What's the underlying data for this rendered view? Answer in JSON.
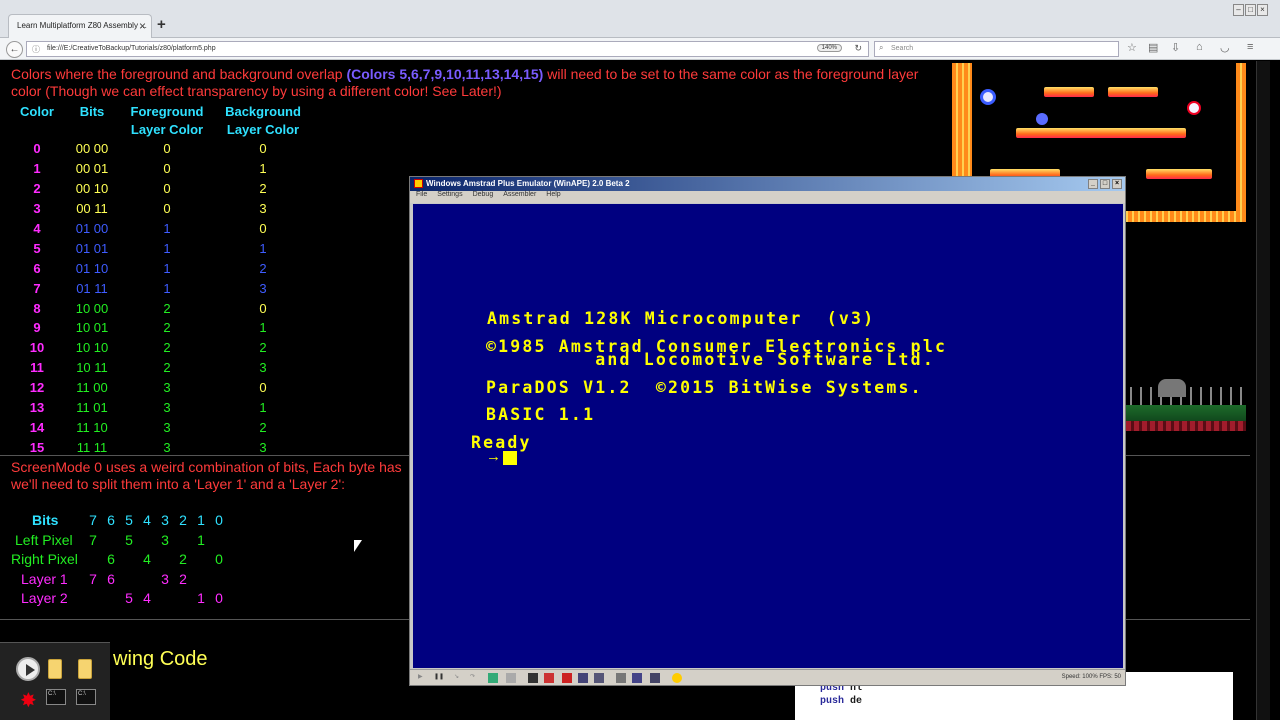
{
  "browser": {
    "tab_title": "Learn Multiplatform Z80 Assembly ...",
    "tab_close": "×",
    "new_tab": "+",
    "url": "file:///E:/CreativeToBackup/Tutorials/z80/platform5.php",
    "zoom": "140%",
    "search_placeholder": "Search"
  },
  "page": {
    "intro_line_plain": "Colors where the foreground and background overlap ",
    "intro_line_highlight": "(Colors 5,6,7,9,10,11,13,14,15)",
    "intro_line_rest": " will need to be set to the same color as the foreground layer color (Though we can effect transparency by using a different color! See Later!)",
    "table": {
      "headers": [
        "Color",
        "Bits",
        "Foreground Layer Color",
        "Background Layer Color"
      ],
      "rows": [
        {
          "color": "0",
          "bits": "00 00",
          "fg": "0",
          "bg": "0"
        },
        {
          "color": "1",
          "bits": "00 01",
          "fg": "0",
          "bg": "1"
        },
        {
          "color": "2",
          "bits": "00 10",
          "fg": "0",
          "bg": "2"
        },
        {
          "color": "3",
          "bits": "00 11",
          "fg": "0",
          "bg": "3"
        },
        {
          "color": "4",
          "bits": "01 00",
          "fg": "1",
          "bg": "0"
        },
        {
          "color": "5",
          "bits": "01 01",
          "fg": "1",
          "bg": "1"
        },
        {
          "color": "6",
          "bits": "01 10",
          "fg": "1",
          "bg": "2"
        },
        {
          "color": "7",
          "bits": "01 11",
          "fg": "1",
          "bg": "3"
        },
        {
          "color": "8",
          "bits": "10 00",
          "fg": "2",
          "bg": "0"
        },
        {
          "color": "9",
          "bits": "10 01",
          "fg": "2",
          "bg": "1"
        },
        {
          "color": "10",
          "bits": "10 10",
          "fg": "2",
          "bg": "2"
        },
        {
          "color": "11",
          "bits": "10 11",
          "fg": "2",
          "bg": "3"
        },
        {
          "color": "12",
          "bits": "11 00",
          "fg": "3",
          "bg": "0"
        },
        {
          "color": "13",
          "bits": "11 01",
          "fg": "3",
          "bg": "1"
        },
        {
          "color": "14",
          "bits": "11 10",
          "fg": "3",
          "bg": "2"
        },
        {
          "color": "15",
          "bits": "11 11",
          "fg": "3",
          "bg": "3"
        }
      ]
    },
    "screenmode_text": "ScreenMode 0 uses a weird combination of bits, Each byte has",
    "screenmode_text2": "we'll need to split them into a 'Layer 1' and a 'Layer 2':",
    "bits_table": {
      "bits_label": "Bits",
      "bits_values": [
        "7",
        "6",
        "5",
        "4",
        "3",
        "2",
        "1",
        "0"
      ],
      "left_label": "Left Pixel",
      "left_values": [
        "7",
        "5",
        "3",
        "1"
      ],
      "right_label": "Right Pixel",
      "right_values": [
        "6",
        "4",
        "2",
        "0"
      ],
      "layer1_label": "Layer 1",
      "layer1_values": [
        "7",
        "6",
        "3",
        "2"
      ],
      "layer2_label": "Layer 2",
      "layer2_values": [
        "5",
        "4",
        "1",
        "0"
      ]
    },
    "next_heading": "wing Code",
    "code_lines": [
      {
        "op": "push",
        "arg": "hl"
      },
      {
        "op": "push",
        "arg": "de"
      }
    ]
  },
  "emulator": {
    "title": "Windows Amstrad Plus Emulator (WinAPE) 2.0 Beta 2",
    "menu": [
      "File",
      "Settings",
      "Debug",
      "Assembler",
      "Help"
    ],
    "screen_lines": [
      "Amstrad 128K Microcomputer  (v3)",
      "©1985 Amstrad Consumer Electronics plc",
      "         and Locomotive Software Ltd.",
      "ParaDOS V1.2  ©2015 BitWise Systems.",
      "BASIC 1.1",
      "Ready"
    ],
    "status": "Speed: 100%  FPS: 50"
  },
  "colors": {
    "red": "#ff3b3b",
    "cyan": "#2fe1ff",
    "yellow": "#ffff55",
    "green": "#22ee22",
    "blue": "#3e5cff",
    "magenta": "#ff2cff",
    "amstrad_bg": "#000080",
    "amstrad_fg": "#ffff00"
  }
}
